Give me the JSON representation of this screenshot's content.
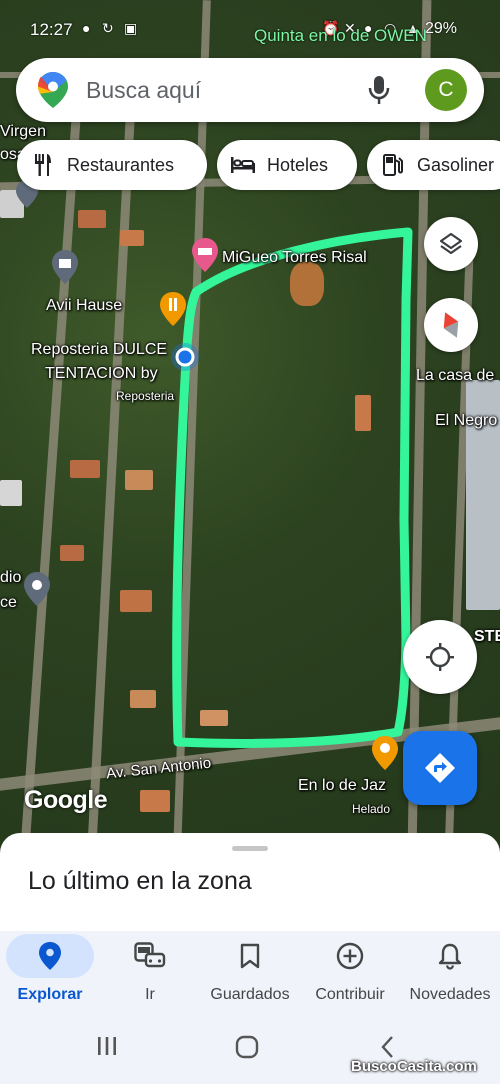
{
  "status_bar": {
    "time": "12:27",
    "network_name": "Quinta en lo de OWEN",
    "battery": "29%"
  },
  "search": {
    "placeholder": "Busca aquí",
    "avatar_letter": "C"
  },
  "chips": [
    {
      "label": "Restaurantes",
      "icon": "fork-knife-icon"
    },
    {
      "label": "Hoteles",
      "icon": "bed-icon"
    },
    {
      "label": "Gasoliner",
      "icon": "gas-station-icon"
    }
  ],
  "map": {
    "labels": {
      "virgen": "Virgen",
      "osa": "osa",
      "migueo": "MiGueo Torres Risal",
      "avii": "Avii Hause",
      "reposteria": "Reposteria DULCE",
      "tentacion": "TENTACION by",
      "reposteria_small": "Reposteria",
      "casa": "La casa de",
      "negro": "El Negro",
      "dio": "dio",
      "ce": "ce",
      "ste": "STE",
      "jaz": "En lo de Jaz",
      "helado": "Helado",
      "av_san_antonio": "Av. San Antonio"
    },
    "attribution": "Google",
    "highlight_color": "#34f59a",
    "accent_color": "#1a73e8"
  },
  "sheet": {
    "title": "Lo último en la zona"
  },
  "bottom_nav": [
    {
      "label": "Explorar",
      "icon": "location-pin-icon",
      "active": true
    },
    {
      "label": "Ir",
      "icon": "commute-icon",
      "active": false
    },
    {
      "label": "Guardados",
      "icon": "bookmark-icon",
      "active": false
    },
    {
      "label": "Contribuir",
      "icon": "add-circle-icon",
      "active": false
    },
    {
      "label": "Novedades",
      "icon": "bell-icon",
      "active": false
    }
  ],
  "watermark": "BuscoCasita.com"
}
